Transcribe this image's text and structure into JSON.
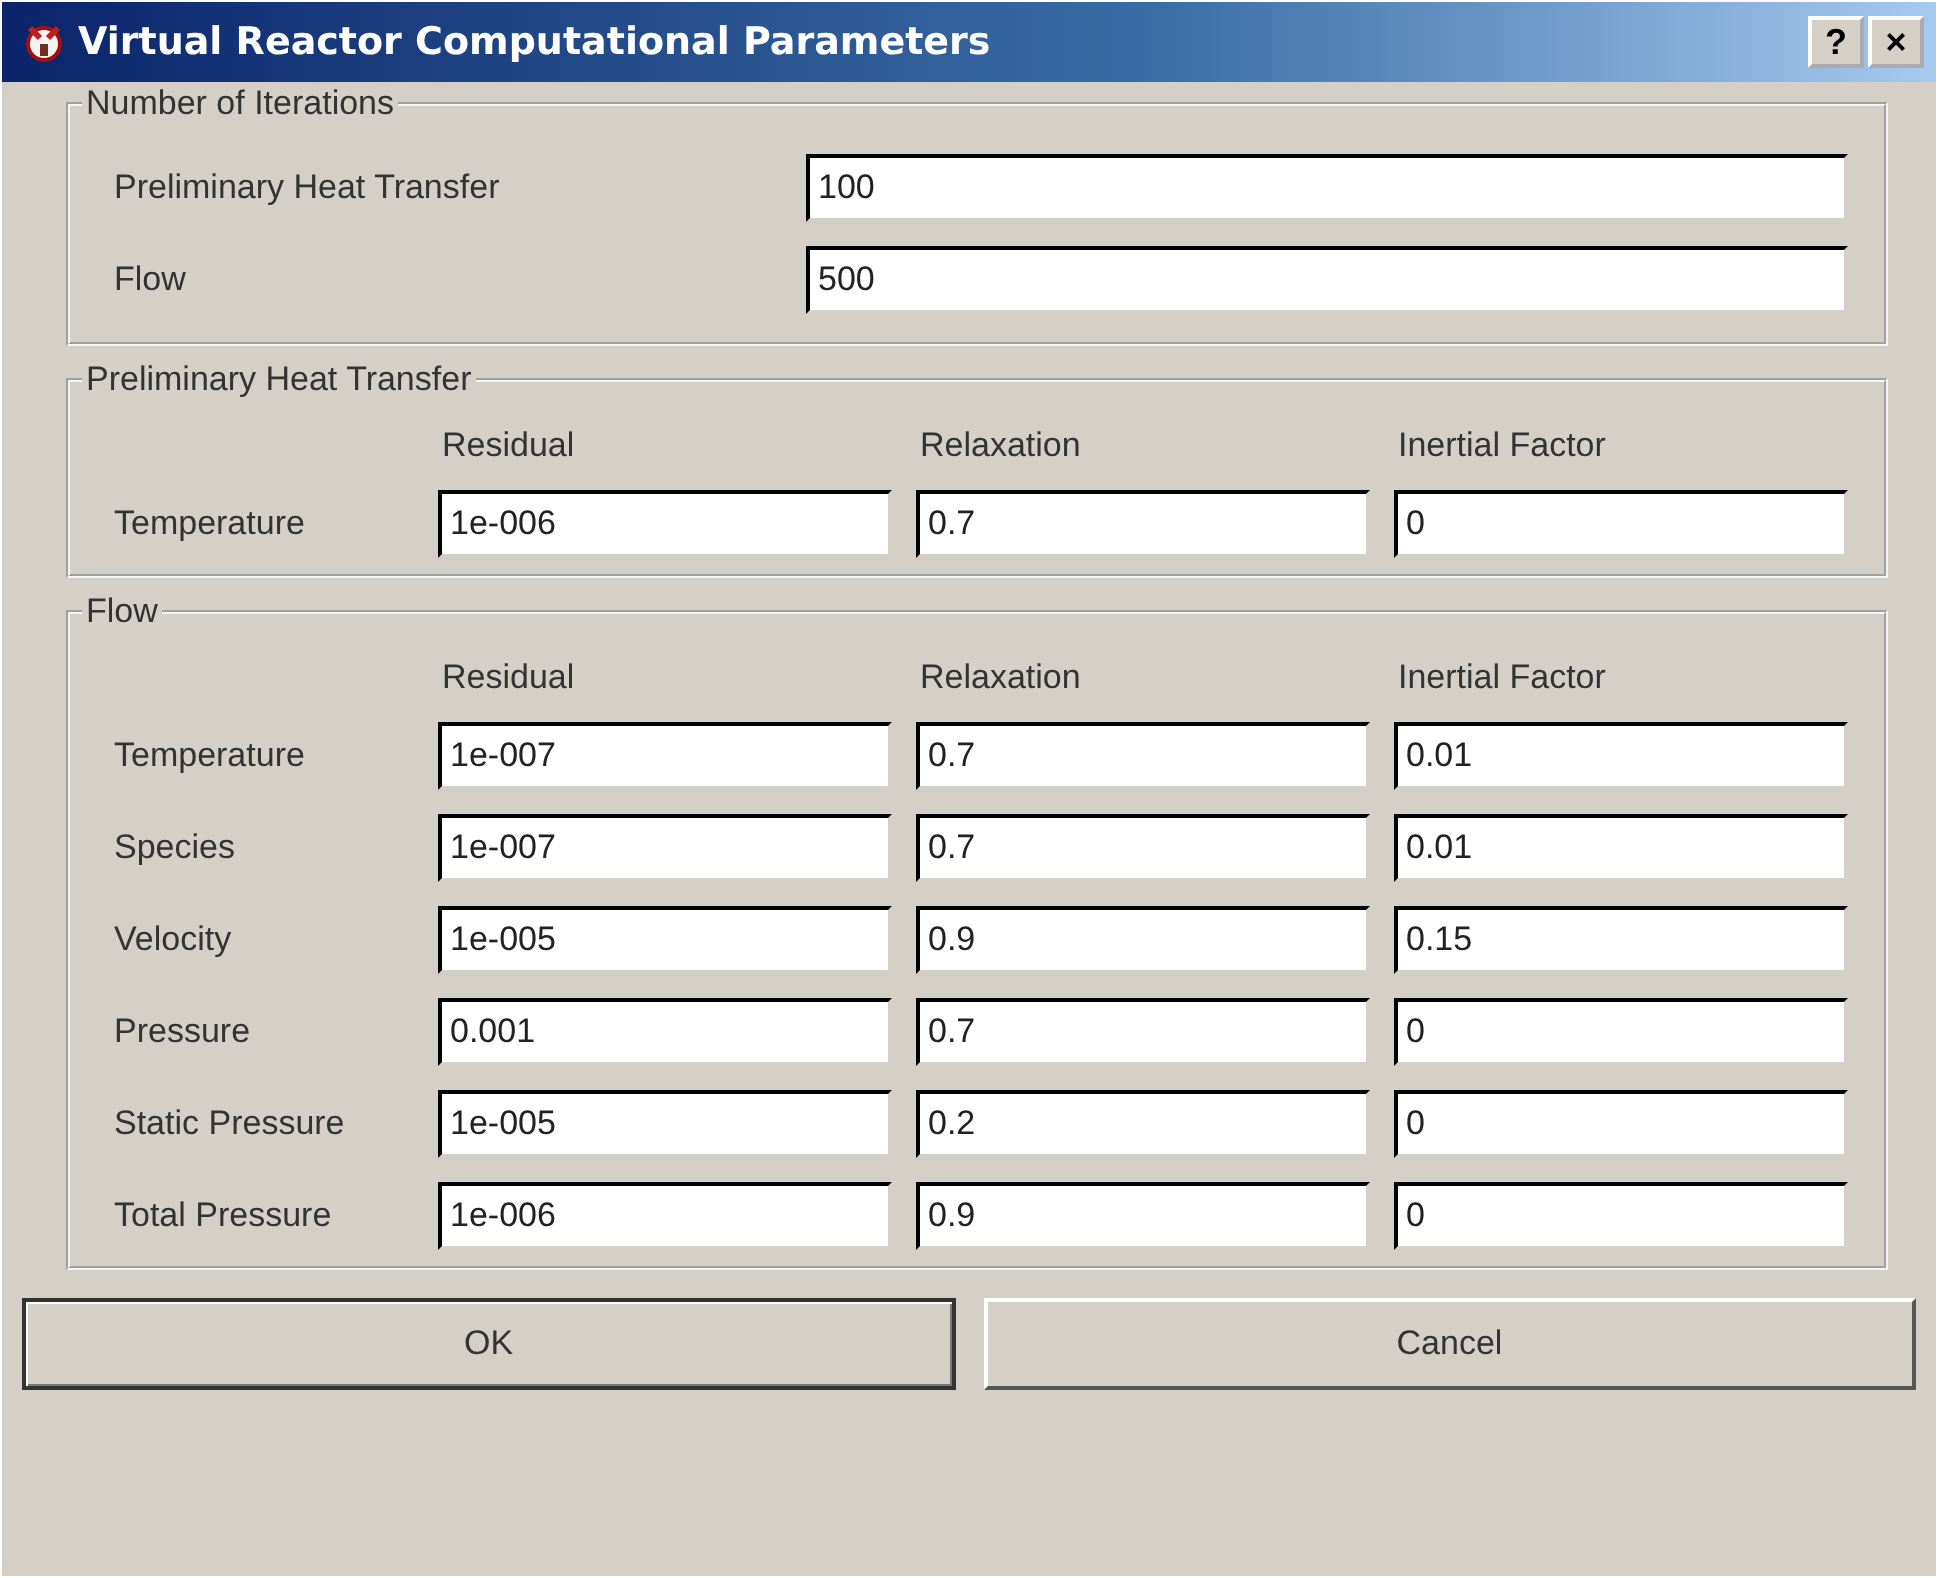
{
  "window": {
    "title": "Virtual Reactor Computational Parameters",
    "buttons": [
      "?",
      "×"
    ]
  },
  "iterations": {
    "title": "Number of Iterations",
    "rows": [
      {
        "label": "Preliminary Heat Transfer",
        "value": "100"
      },
      {
        "label": "Flow",
        "value": "500"
      }
    ]
  },
  "heat_transfer": {
    "title": "Preliminary Heat Transfer",
    "columns": [
      "Residual",
      "Relaxation",
      "Inertial Factor"
    ],
    "rows": [
      {
        "label": "Temperature",
        "values": [
          "1e-006",
          "0.7",
          "0"
        ]
      }
    ]
  },
  "flow": {
    "title": "Flow",
    "columns": [
      "Residual",
      "Relaxation",
      "Inertial Factor"
    ],
    "rows": [
      {
        "label": "Temperature",
        "values": [
          "1e-007",
          "0.7",
          "0.01"
        ]
      },
      {
        "label": "Species",
        "values": [
          "1e-007",
          "0.7",
          "0.01"
        ]
      },
      {
        "label": "Velocity",
        "values": [
          "1e-005",
          "0.9",
          "0.15"
        ]
      },
      {
        "label": "Pressure",
        "values": [
          "0.001",
          "0.7",
          "0"
        ]
      },
      {
        "label": "Static Pressure",
        "values": [
          "1e-005",
          "0.2",
          "0"
        ]
      },
      {
        "label": "Total Pressure",
        "values": [
          "1e-006",
          "0.9",
          "0"
        ]
      }
    ]
  },
  "buttons": [
    {
      "label": "OK",
      "default": true
    },
    {
      "label": "Cancel",
      "default": false
    }
  ]
}
